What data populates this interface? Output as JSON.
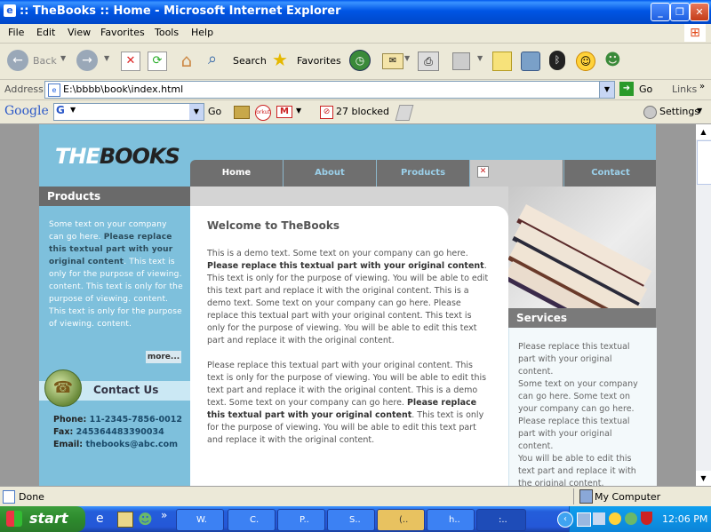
{
  "window": {
    "title": ":: TheBooks :: Home - Microsoft Internet Explorer"
  },
  "menubar": [
    "File",
    "Edit",
    "View",
    "Favorites",
    "Tools",
    "Help"
  ],
  "toolbar": {
    "back_label": "Back",
    "search_label": "Search",
    "favorites_label": "Favorites"
  },
  "addressbar": {
    "label": "Address",
    "url": "E:\\bbbb\\book\\index.html",
    "go_label": "Go",
    "links_label": "Links"
  },
  "googlebar": {
    "logo": "Google",
    "go_label": "Go",
    "blocked_label": "27 blocked",
    "settings_label": "Settings"
  },
  "site": {
    "logo_the": "THE",
    "logo_books": "BOOKS",
    "nav": [
      "Home",
      "About",
      "Products",
      "Contact"
    ],
    "products_heading": "Products",
    "products_text": {
      "part1": "Some text on your company can go here. ",
      "part2_bold": "Please replace this textual part with your original content",
      "part3": ". This text is only for the purpose of viewing. content. This text is only for the purpose of viewing. content. This text is only for the purpose of viewing. content."
    },
    "more_label": "more...",
    "contact_heading": "Contact Us",
    "phone_label": "Phone:",
    "phone": "11-2345-7856-0012",
    "fax_label": "Fax:",
    "fax": "245364483390034",
    "email_label": "Email:",
    "email": "thebooks@abc.com",
    "welcome_title": "Welcome to TheBooks",
    "para1": {
      "a": "This is a demo text. Some text on your company can go here. ",
      "b_bold": "Please replace this textual part with your original content",
      "c": ". This text is only for the purpose of viewing. You will be able to edit this text part and replace it with the original content. This is a demo text. Some text on your company can go here. Please replace this textual part with your original content. This text is only for the purpose of viewing. You will be able to edit this text part and replace it with the original content."
    },
    "para2": {
      "a": "Please replace this textual part with your original content. This text is only for the purpose of viewing. You will be able to edit this text part and replace it with the original content. This is a demo text. Some text on your company can go here. ",
      "b_bold": "Please replace this textual part with your original content",
      "c": ". This text is only for the purpose of viewing. You will be able to edit this text part and replace it with the original content."
    },
    "services_heading": "Services",
    "services_text": "Please replace this textual part with your original content.\nSome text on your company can go here. Some text on your company can go here.\nPlease replace this textual part with your original content.\nYou will be able to edit this text part and replace it with the original content."
  },
  "statusbar": {
    "status": "Done",
    "zone": "My Computer"
  },
  "taskbar": {
    "start_label": "start",
    "tasks": [
      "W.",
      "C.",
      "P..",
      "S..",
      "(..",
      "h..",
      ":.."
    ],
    "clock": "12:06 PM"
  },
  "colors": {
    "site_blue": "#7EC0DC",
    "nav_gray": "#6F6F6F",
    "xp_blue": "#0058EE"
  }
}
